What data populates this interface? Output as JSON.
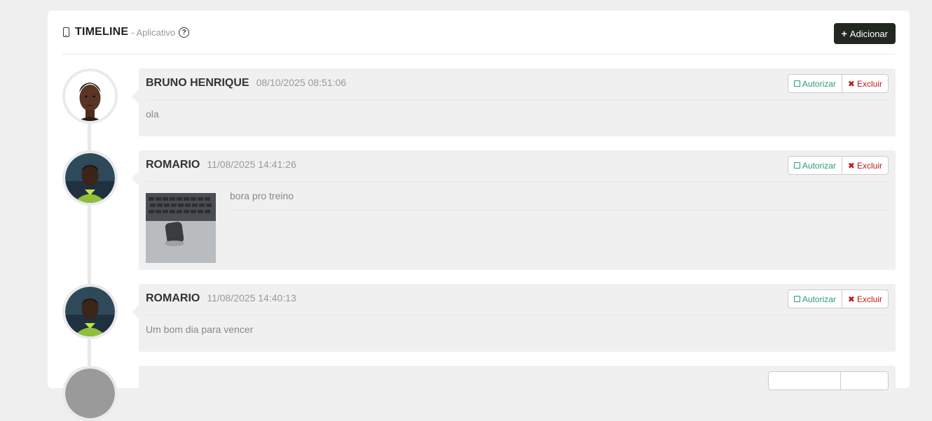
{
  "header": {
    "title": "TIMELINE",
    "subtitle": "- Aplicativo",
    "help_glyph": "?",
    "add_label": "Adicionar",
    "add_glyph": "+"
  },
  "posts": [
    {
      "author": "BRUNO HENRIQUE",
      "timestamp": "08/10/2025 08:51:06",
      "text": "ola",
      "authorize_label": "Autorizar",
      "delete_label": "Excluir"
    },
    {
      "author": "ROMARIO",
      "timestamp": "11/08/2025 14:41:26",
      "text": "bora pro treino",
      "authorize_label": "Autorizar",
      "delete_label": "Excluir"
    },
    {
      "author": "ROMARIO",
      "timestamp": "11/08/2025 14:40:13",
      "text": "Um bom dia para vencer",
      "authorize_label": "Autorizar",
      "delete_label": "Excluir"
    }
  ],
  "colors": {
    "add_button_bg": "#222720",
    "authorize": "#2a9d6f",
    "delete": "#b71c1c"
  },
  "icons": [
    "mobile-phone-icon",
    "question-circle-icon",
    "plus-icon",
    "checkbox-icon",
    "close-icon"
  ]
}
